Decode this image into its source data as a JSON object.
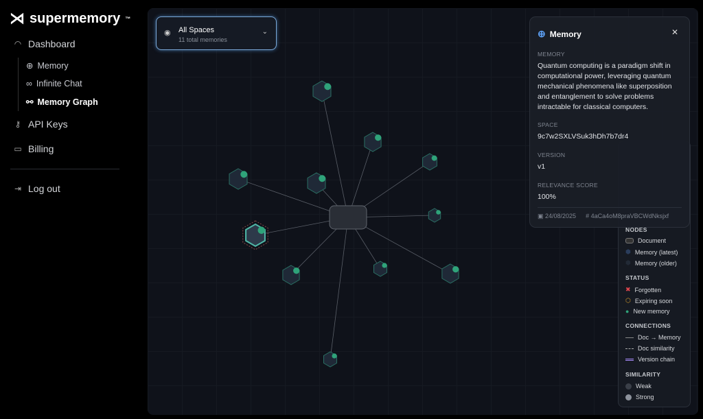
{
  "brand": {
    "name": "supermemory",
    "tm": "™"
  },
  "sidebar": {
    "dashboard": "Dashboard",
    "sub": [
      {
        "label": "Memory",
        "icon": "brain-icon"
      },
      {
        "label": "Infinite Chat",
        "icon": "infinity-icon"
      },
      {
        "label": "Memory Graph",
        "icon": "graph-icon"
      }
    ],
    "api_keys": "API Keys",
    "billing": "Billing",
    "logout": "Log out"
  },
  "spaces": {
    "title": "All Spaces",
    "subtitle": "11 total memories"
  },
  "panel": {
    "title": "Memory",
    "memory_label": "MEMORY",
    "memory_text": "Quantum computing is a paradigm shift in computational power, leveraging quantum mechanical phenomena like superposition and entanglement to solve problems intractable for classical computers.",
    "space_label": "SPACE",
    "space": "9c7w2SXLVSuk3hDh7b7dr4",
    "version_label": "VERSION",
    "version": "v1",
    "score_label": "RELEVANCE SCORE",
    "score": "100%",
    "date": "24/08/2025",
    "id": "4aCa4oM8praVBCWdNksjxf"
  },
  "legend": {
    "nodes_h": "NODES",
    "document": "Document",
    "mem_latest": "Memory (latest)",
    "mem_older": "Memory (older)",
    "status_h": "STATUS",
    "forgotten": "Forgotten",
    "expiring": "Expiring soon",
    "new_memory": "New memory",
    "conn_h": "CONNECTIONS",
    "doc_mem": "Doc → Memory",
    "doc_sim": "Doc similarity",
    "version_chain": "Version chain",
    "sim_h": "SIMILARITY",
    "weak": "Weak",
    "strong": "Strong"
  },
  "colors": {
    "accent": "#2fa37a",
    "node_fill": "#1f2937",
    "node_stroke": "#2a6f63",
    "selected_stroke": "#4fb8a8"
  }
}
